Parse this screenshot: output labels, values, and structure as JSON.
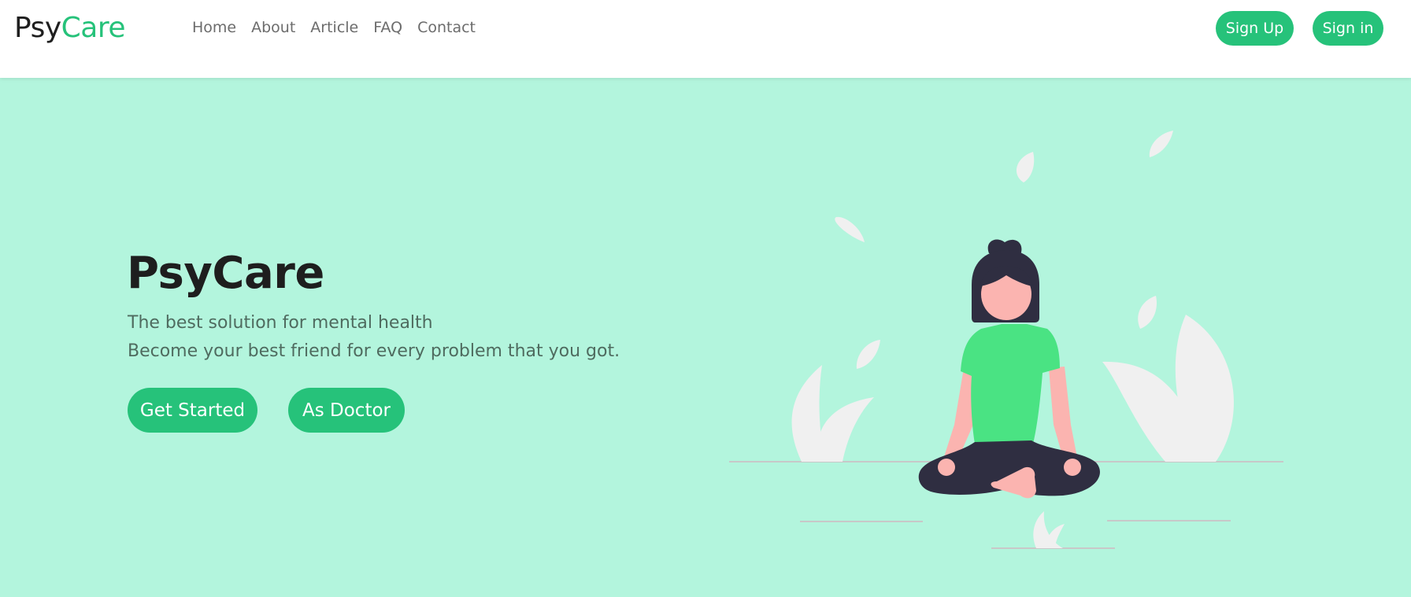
{
  "nav": {
    "brand_part1": "Psy",
    "brand_part2": "Care",
    "links": [
      "Home",
      "About",
      "Article",
      "FAQ",
      "Contact"
    ],
    "signup_label": "Sign Up",
    "signin_label": "Sign in"
  },
  "hero": {
    "title": "PsyCare",
    "subtitle_line1": "The best solution for mental health",
    "subtitle_line2": "Become your best friend for every problem that you got.",
    "get_started_label": "Get Started",
    "as_doctor_label": "As Doctor"
  },
  "colors": {
    "accent": "#26c27a",
    "hero_background": "#b3f5dd",
    "navbar_background": "#ffffff",
    "shirt": "#4ae383",
    "skin": "#fbb4b0",
    "hair_pants": "#2f2e41",
    "leaves": "#f0f0f0"
  }
}
